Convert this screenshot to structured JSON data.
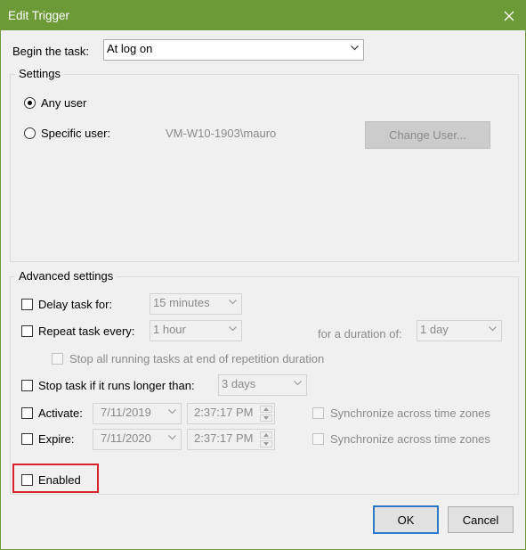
{
  "window": {
    "title": "Edit Trigger"
  },
  "begin": {
    "label": "Begin the task:",
    "value": "At log on"
  },
  "settings": {
    "title": "Settings",
    "any_user": "Any user",
    "specific_user": "Specific user:",
    "user_name": "VM-W10-1903\\mauro",
    "change_user": "Change User..."
  },
  "advanced": {
    "title": "Advanced settings",
    "delay_label": "Delay task for:",
    "delay_value": "15 minutes",
    "repeat_label": "Repeat task every:",
    "repeat_value": "1 hour",
    "duration_label": "for a duration of:",
    "duration_value": "1 day",
    "stop_running": "Stop all running tasks at end of repetition duration",
    "stop_longer_label": "Stop task if it runs longer than:",
    "stop_longer_value": "3 days",
    "activate_label": "Activate:",
    "activate_date": "7/11/2019",
    "activate_time": "2:37:17 PM",
    "expire_label": "Expire:",
    "expire_date": "7/11/2020",
    "expire_time": "2:37:17 PM",
    "sync_label": "Synchronize across time zones",
    "enabled": "Enabled"
  },
  "buttons": {
    "ok": "OK",
    "cancel": "Cancel"
  },
  "colors": {
    "titlebar": "#6b9a36",
    "highlight": "#d9232c",
    "ok_border": "#2f77c7"
  }
}
